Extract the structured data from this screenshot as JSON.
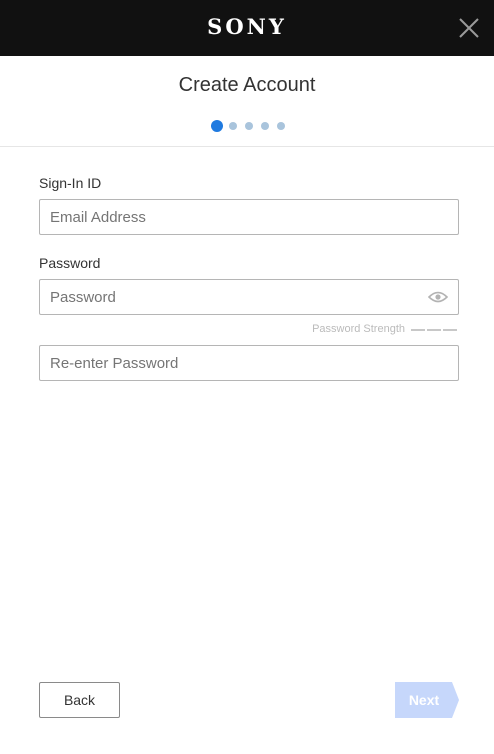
{
  "header": {
    "brand": "SONY",
    "close_icon": "close-icon"
  },
  "page": {
    "title": "Create Account",
    "steps": {
      "total": 5,
      "current": 1
    }
  },
  "form": {
    "signin_label": "Sign-In ID",
    "email_placeholder": "Email Address",
    "email_value": "",
    "password_label": "Password",
    "password_placeholder": "Password",
    "password_value": "",
    "show_password_icon": "eye-icon",
    "strength_label": "Password Strength",
    "reenter_placeholder": "Re-enter Password",
    "reenter_value": ""
  },
  "footer": {
    "back_label": "Back",
    "next_label": "Next",
    "next_enabled": false
  },
  "colors": {
    "topbar": "#111111",
    "accent": "#1f7ae0",
    "dot_inactive": "#a9c4dc",
    "next_disabled": "#c6d7fb"
  }
}
